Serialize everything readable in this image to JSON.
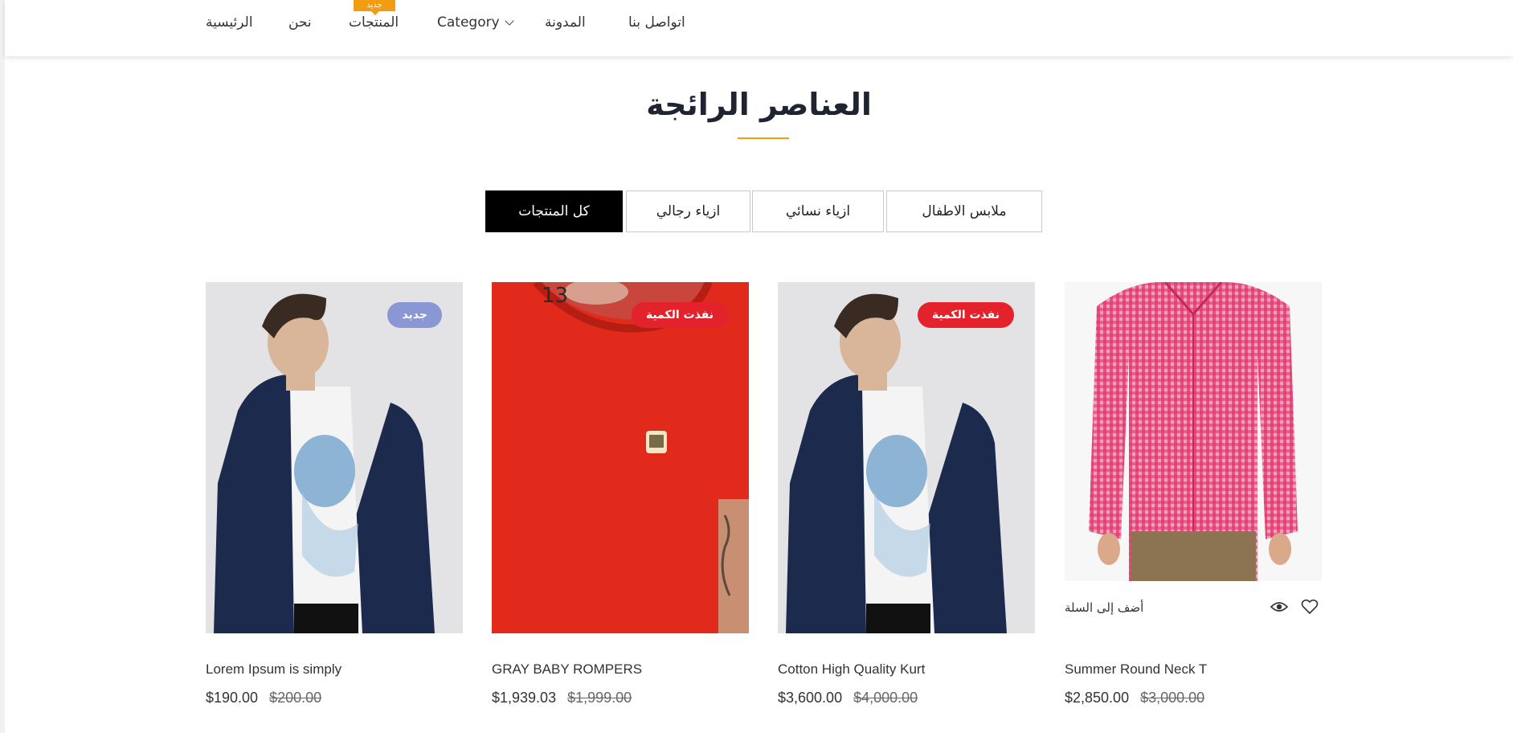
{
  "nav": {
    "items": [
      {
        "label": "اتواصل بنا"
      },
      {
        "label": "المدونة"
      },
      {
        "label": "Category"
      },
      {
        "label": "المنتجات"
      },
      {
        "label": "نحن"
      },
      {
        "label": "الرئيسية"
      }
    ],
    "badge": "جديد"
  },
  "section": {
    "title": "العناصر الرائجة"
  },
  "tabs": [
    {
      "label": "ملابس الاطفال"
    },
    {
      "label": "ازياء نسائي"
    },
    {
      "label": "ازياء رجالي"
    },
    {
      "label": "كل المنتجات",
      "active": true
    }
  ],
  "products": [
    {
      "name": "Lorem Ipsum is simply",
      "price": "$190.00",
      "old_price": "$200.00",
      "badge": "جديد",
      "image": "man-in-navy-blazer"
    },
    {
      "name": "GRAY BABY ROMPERS",
      "price": "$1,939.03",
      "old_price": "$1,999.00",
      "badge": "نفذت الكمية",
      "image": "red-tshirt-closeup"
    },
    {
      "name": "Cotton High Quality Kurt",
      "price": "$3,600.00",
      "old_price": "$4,000.00",
      "badge": "نفذت الكمية",
      "image": "man-in-navy-blazer"
    },
    {
      "name": "Summer Round Neck T",
      "price": "$2,850.00",
      "old_price": "$3,000.00",
      "badge": "",
      "image": "red-gingham-shirt",
      "add_to_cart": "أضف إلى السلة"
    }
  ],
  "colors": {
    "accent": "#f39c12",
    "badge_new": "#8b96d4",
    "badge_sold": "#e3222b",
    "tab_active": "#000000"
  }
}
